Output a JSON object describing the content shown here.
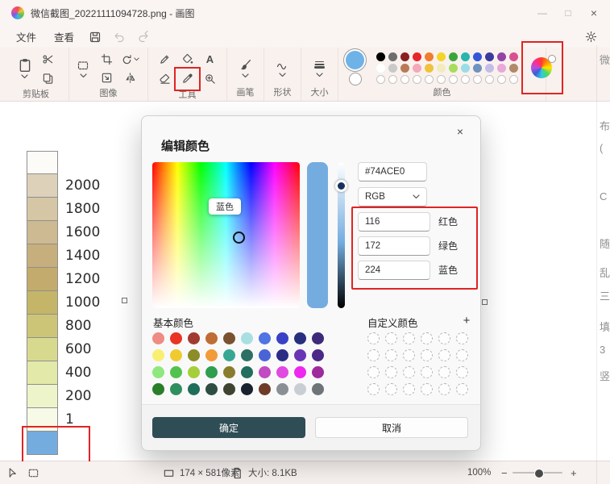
{
  "titlebar": {
    "title": "微信截图_20221111094728.png - 画图",
    "minimize": "—",
    "maximize": "□",
    "close": "×"
  },
  "menubar": {
    "file": "文件",
    "view": "查看"
  },
  "ribbon": {
    "sections": {
      "clipboard": "剪贴板",
      "image": "图像",
      "tools": "工具",
      "brushes": "画笔",
      "shapes": "形状",
      "size": "大小",
      "colors": "颜色"
    },
    "color1": "#6fb2e8",
    "color2": "#ffffff",
    "palette_row1": [
      "#000000",
      "#6e6e6e",
      "#8c1f1f",
      "#e8252a",
      "#f07c2e",
      "#f5d327",
      "#3ba53a",
      "#27b5ae",
      "#3358d8",
      "#3b3b9e",
      "#9343a8",
      "#d8518f"
    ],
    "palette_row2": [
      "#ffffff",
      "#c9c9c9",
      "#b97a57",
      "#f5a8b8",
      "#f0c23e",
      "#f2ecbc",
      "#a8dc5a",
      "#9adce8",
      "#7092be",
      "#c4bce8",
      "#e8a8d8",
      "#b08968"
    ],
    "palette_empty_slots": 12
  },
  "canvas": {
    "legend": [
      {
        "label": "",
        "color": "#fcfbf8"
      },
      {
        "label": "2000",
        "color": "#ddd1ba"
      },
      {
        "label": "1800",
        "color": "#d5c6a6"
      },
      {
        "label": "1600",
        "color": "#cdb992"
      },
      {
        "label": "1400",
        "color": "#c6af7d"
      },
      {
        "label": "1200",
        "color": "#c2ab6c"
      },
      {
        "label": "1000",
        "color": "#c4b569"
      },
      {
        "label": "800",
        "color": "#ccc577"
      },
      {
        "label": "600",
        "color": "#d7da8e"
      },
      {
        "label": "400",
        "color": "#e2e9a9"
      },
      {
        "label": "200",
        "color": "#eef4ca"
      },
      {
        "label": "1",
        "color": "#f7fae6"
      },
      {
        "label": "",
        "color": "#74ace0",
        "highlighted": true
      }
    ],
    "background_text": [
      "微",
      "布",
      "(",
      "C",
      "随",
      "乱",
      "三",
      "填",
      "3",
      "竖"
    ]
  },
  "dialog": {
    "title": "编辑颜色",
    "close": "×",
    "tooltip": "蓝色",
    "hex": "#74ACE0",
    "mode": "RGB",
    "channels": [
      {
        "value": "116",
        "label": "红色"
      },
      {
        "value": "172",
        "label": "绿色"
      },
      {
        "value": "224",
        "label": "蓝色"
      }
    ],
    "basic_label": "基本颜色",
    "custom_label": "自定义颜色",
    "add_button": "+",
    "ok": "确定",
    "cancel": "取消",
    "basic_colors": [
      [
        "#ef8b84",
        "#e93323",
        "#a13b32",
        "#c06c35",
        "#7a5230",
        "#a8dfe3",
        "#4f74e3",
        "#3a41c6",
        "#27307e",
        "#3d2a7a"
      ],
      [
        "#f8ef71",
        "#efcb30",
        "#8c8c28",
        "#f29b38",
        "#37a794",
        "#2e6f64",
        "#4a64d8",
        "#2a2c86",
        "#6a35b5",
        "#4a2a86"
      ],
      [
        "#8ee87e",
        "#52c24e",
        "#a4cf3a",
        "#2f9e4e",
        "#8a7c2e",
        "#1f6e5e",
        "#c24ac2",
        "#e04ae0",
        "#ee28ee",
        "#9e2a9e"
      ],
      [
        "#2a7e2a",
        "#2f8f5e",
        "#1e6e5a",
        "#2e4e44",
        "#3e4430",
        "#1a2230",
        "#6e3a2a",
        "#8a8f94",
        "#c9ced4",
        "#6f7478"
      ]
    ],
    "custom_rows": 4,
    "custom_cols": 6
  },
  "statusbar": {
    "dimensions": "174 × 581像素",
    "filesize": "大小: 8.1KB",
    "zoom": "100%",
    "zoom_minus": "−",
    "zoom_plus": "+"
  },
  "annotations": {
    "color": "#e02424",
    "targets": [
      "eyedropper-tool",
      "edit-color-button",
      "rgb-channel-inputs",
      "legend-blue-swatch"
    ]
  },
  "icons": {
    "app_logo": "palette-circle",
    "save": "floppy",
    "undo": "arc-arrow-left",
    "redo": "arc-arrow-right",
    "settings": "gear",
    "paste": "clipboard",
    "cut": "scissors",
    "copy": "pages",
    "select": "dashed-rect",
    "crop": "crop-corners",
    "resize": "rect-diag-arrow",
    "rotate": "circular-arrow",
    "flip": "mirrored-triangles",
    "pencil": "pencil",
    "fill": "paint-bucket",
    "text_glyph": "A",
    "eraser": "slanted-block",
    "picker": "eyedropper",
    "magnifier": "magnifier-plus",
    "brush": "paint-brush",
    "shapes": "squiggle-line",
    "size": "line-weights",
    "chevron": "chevron-down",
    "cursor": "pointer-arrow",
    "selection": "dashed-rect",
    "dimensions": "rectangle",
    "filesize": "document-page",
    "color_wheel": "rainbow-circle"
  }
}
